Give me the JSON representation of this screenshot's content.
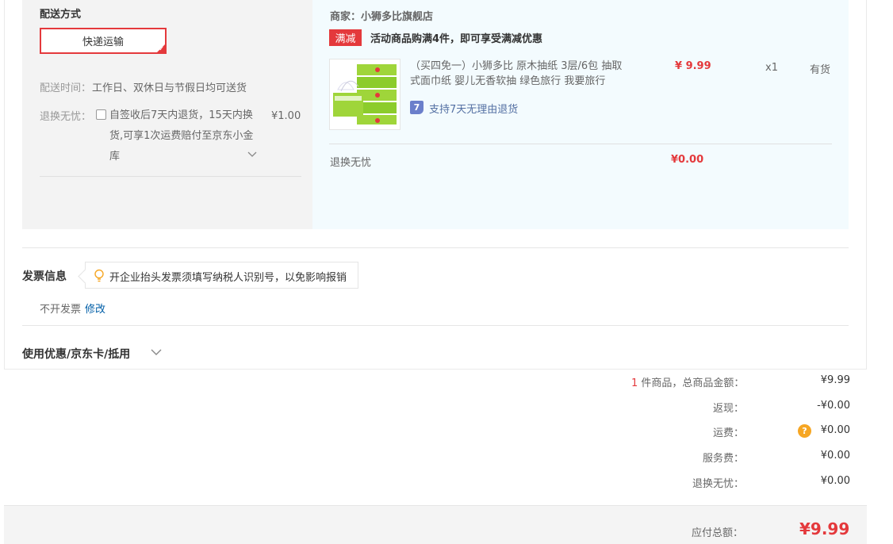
{
  "shipping": {
    "title": "配送方式",
    "method_button": "快递运输",
    "time_label": "配送时间：",
    "time_value": "工作日、双休日与节假日均可送货",
    "return_label": "退换无忧：",
    "return_desc": "自签收后7天内退货，15天内换货,可享1次运费赔付至京东小金库",
    "return_price": "¥1.00"
  },
  "store": {
    "merchant": "商家：小狮多比旗舰店",
    "promo_badge": "满减",
    "promo_text": "活动商品购满4件，即可享受满减优惠"
  },
  "product": {
    "name": "（买四免一）小狮多比 原木抽纸 3层/6包 抽取式面巾纸 婴儿无香软抽 绿色旅行 我要旅行",
    "support_icon_text": "7",
    "support_text": "支持7天无理由退货",
    "price": "¥ 9.99",
    "quantity": "x1",
    "stock": "有货",
    "return_row_label": "退换无忧",
    "return_row_price": "¥0.00"
  },
  "invoice": {
    "title": "发票信息",
    "tip": "开企业抬头发票须填写纳税人识别号，以免影响报销",
    "value": "不开发票",
    "edit_link": "修改"
  },
  "coupon": {
    "title": "使用优惠/京东卡/抵用"
  },
  "summary": {
    "item_count": "1",
    "items_label": " 件商品，总商品金额：",
    "items_value": "¥9.99",
    "rebate_label": "返现：",
    "rebate_value": "-¥0.00",
    "freight_label": "运费：",
    "freight_icon": "?",
    "freight_value": "¥0.00",
    "service_label": "服务费：",
    "service_value": "¥0.00",
    "return_label": "退换无忧：",
    "return_value": "¥0.00",
    "total_label": "应付总额：",
    "total_value": "¥9.99"
  },
  "colors": {
    "accent_red": "#e4393c",
    "link_blue": "#005ea7",
    "product_panel_bg": "#f3fbfe",
    "shipping_panel_bg": "#f3f3f3",
    "freight_icon_orange": "#f6a623"
  },
  "icons": [
    "checkmark-corner-icon",
    "chevron-down-icon",
    "support-7day-icon",
    "lightbulb-icon",
    "question-icon"
  ]
}
